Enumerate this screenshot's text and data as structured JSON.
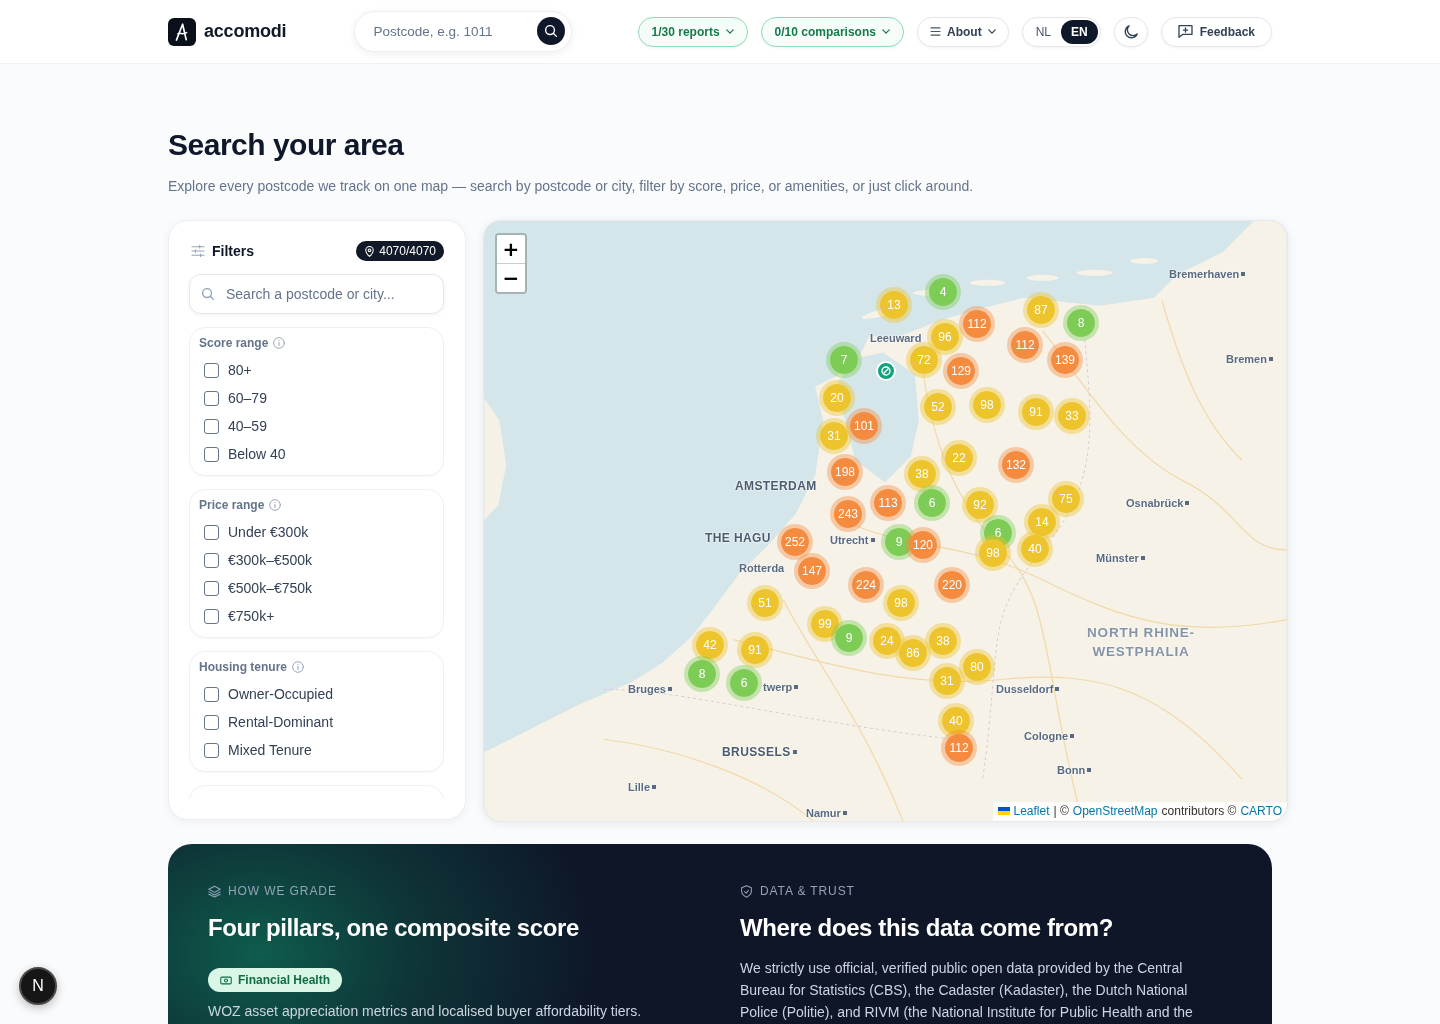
{
  "header": {
    "brand": "accomodi",
    "search": {
      "placeholder": "Postcode, e.g. 1011"
    },
    "counters": [
      {
        "label": "1/30 reports"
      },
      {
        "label": "0/10 comparisons"
      }
    ],
    "about": {
      "label": "About"
    },
    "languages": [
      {
        "label": "NL",
        "selected": false
      },
      {
        "label": "EN",
        "selected": true
      }
    ],
    "feedback": {
      "label": "Feedback"
    }
  },
  "intro": {
    "title": "Search your area",
    "subtitle": "Explore every postcode we track on one map — search by postcode or city, filter by score, price, or amenities, or just click around."
  },
  "filters": {
    "title": "Filters",
    "count": "4070/4070",
    "search": {
      "placeholder": "Search a postcode or city..."
    },
    "groups": [
      {
        "title": "Score range",
        "options": [
          {
            "label": "80+",
            "checked": false
          },
          {
            "label": "60–79",
            "checked": false
          },
          {
            "label": "40–59",
            "checked": false
          },
          {
            "label": "Below 40",
            "checked": false
          }
        ]
      },
      {
        "title": "Price range",
        "options": [
          {
            "label": "Under €300k",
            "checked": false
          },
          {
            "label": "€300k–€500k",
            "checked": false
          },
          {
            "label": "€500k–€750k",
            "checked": false
          },
          {
            "label": "€750k+",
            "checked": false
          }
        ]
      },
      {
        "title": "Housing tenure",
        "options": [
          {
            "label": "Owner-Occupied",
            "checked": false
          },
          {
            "label": "Rental-Dominant",
            "checked": false
          },
          {
            "label": "Mixed Tenure",
            "checked": false
          }
        ]
      }
    ]
  },
  "map": {
    "zoom": [
      {
        "label": "+"
      },
      {
        "label": "−"
      }
    ],
    "labels": [
      {
        "text": "Bremerhaven",
        "kind": "city",
        "dot": true
      },
      {
        "text": "Leeuward",
        "kind": "city",
        "dot": false
      },
      {
        "text": "Bremen",
        "kind": "city",
        "dot": true
      },
      {
        "text": "AMSTERDAM",
        "kind": "capital",
        "dot": false
      },
      {
        "text": "Osnabrück",
        "kind": "city",
        "dot": true
      },
      {
        "text": "THE HAGU",
        "kind": "capital",
        "dot": false
      },
      {
        "text": "Utrecht",
        "kind": "city",
        "dot": true
      },
      {
        "text": "Rotterda",
        "kind": "city",
        "dot": false
      },
      {
        "text": "Münster",
        "kind": "city",
        "dot": true
      },
      {
        "text": "NORTH RHINE-WESTPHALIA",
        "kind": "region",
        "dot": false
      },
      {
        "text": "Bruges",
        "kind": "city",
        "dot": true
      },
      {
        "text": "twerp",
        "kind": "city",
        "dot": true
      },
      {
        "text": "Dusseldorf",
        "kind": "city",
        "dot": true
      },
      {
        "text": "Cologne",
        "kind": "city",
        "dot": true
      },
      {
        "text": "BRUSSELS",
        "kind": "capital",
        "dot": true
      },
      {
        "text": "Bonn",
        "kind": "city",
        "dot": true
      },
      {
        "text": "Lille",
        "kind": "city",
        "dot": true
      },
      {
        "text": "Namur",
        "kind": "city",
        "dot": true
      }
    ],
    "markers": [
      {
        "count": "13",
        "color": "#edc42b"
      },
      {
        "count": "4",
        "color": "#7dcc55"
      },
      {
        "count": "112",
        "color": "#f48b3f"
      },
      {
        "count": "87",
        "color": "#edc42b"
      },
      {
        "count": "8",
        "color": "#7dcc55"
      },
      {
        "count": "96",
        "color": "#edc42b"
      },
      {
        "count": "112",
        "color": "#f48b3f"
      },
      {
        "count": "7",
        "color": "#7dcc55"
      },
      {
        "count": "72",
        "color": "#edc42b"
      },
      {
        "count": "139",
        "color": "#f48b3f"
      },
      {
        "count": "129",
        "color": "#f48b3f"
      },
      {
        "count": "20",
        "color": "#edc42b"
      },
      {
        "count": "52",
        "color": "#edc42b"
      },
      {
        "count": "98",
        "color": "#edc42b"
      },
      {
        "count": "91",
        "color": "#edc42b"
      },
      {
        "count": "33",
        "color": "#edc42b"
      },
      {
        "count": "101",
        "color": "#f48b3f"
      },
      {
        "count": "31",
        "color": "#edc42b"
      },
      {
        "count": "198",
        "color": "#f48b3f"
      },
      {
        "count": "38",
        "color": "#edc42b"
      },
      {
        "count": "22",
        "color": "#edc42b"
      },
      {
        "count": "132",
        "color": "#f48b3f"
      },
      {
        "count": "113",
        "color": "#f48b3f"
      },
      {
        "count": "6",
        "color": "#7dcc55"
      },
      {
        "count": "92",
        "color": "#edc42b"
      },
      {
        "count": "75",
        "color": "#edc42b"
      },
      {
        "count": "243",
        "color": "#f48b3f"
      },
      {
        "count": "14",
        "color": "#edc42b"
      },
      {
        "count": "6",
        "color": "#7dcc55"
      },
      {
        "count": "252",
        "color": "#f48b3f"
      },
      {
        "count": "9",
        "color": "#7dcc55"
      },
      {
        "count": "120",
        "color": "#f48b3f"
      },
      {
        "count": "98",
        "color": "#edc42b"
      },
      {
        "count": "40",
        "color": "#edc42b"
      },
      {
        "count": "147",
        "color": "#f48b3f"
      },
      {
        "count": "224",
        "color": "#f48b3f"
      },
      {
        "count": "220",
        "color": "#f48b3f"
      },
      {
        "count": "51",
        "color": "#edc42b"
      },
      {
        "count": "98",
        "color": "#edc42b"
      },
      {
        "count": "99",
        "color": "#edc42b"
      },
      {
        "count": "42",
        "color": "#edc42b"
      },
      {
        "count": "91",
        "color": "#edc42b"
      },
      {
        "count": "9",
        "color": "#7dcc55"
      },
      {
        "count": "24",
        "color": "#edc42b"
      },
      {
        "count": "86",
        "color": "#edc42b"
      },
      {
        "count": "38",
        "color": "#edc42b"
      },
      {
        "count": "8",
        "color": "#7dcc55"
      },
      {
        "count": "6",
        "color": "#7dcc55"
      },
      {
        "count": "31",
        "color": "#edc42b"
      },
      {
        "count": "80",
        "color": "#edc42b"
      },
      {
        "count": "40",
        "color": "#edc42b"
      },
      {
        "count": "112",
        "color": "#f48b3f"
      }
    ],
    "attribution": [
      {
        "kind": "link",
        "text": "Leaflet"
      },
      {
        "kind": "text",
        "text": "| ©"
      },
      {
        "kind": "link",
        "text": "OpenStreetMap"
      },
      {
        "kind": "text",
        "text": "contributors ©"
      },
      {
        "kind": "link",
        "text": "CARTO"
      }
    ]
  },
  "info": {
    "columns": [
      {
        "kind": "grade",
        "eyebrow": "HOW WE GRADE",
        "title": "Four pillars, one composite score",
        "pill": "Financial Health",
        "text": "WOZ asset appreciation metrics and localised buyer affordability tiers."
      },
      {
        "kind": "trust",
        "eyebrow": "DATA & TRUST",
        "title": "Where does this data come from?",
        "text": "We strictly use official, verified public open data provided by the Central Bureau for Statistics (CBS), the Cadaster (Kadaster), the Dutch National Police (Politie), and RIVM (the National Institute for Public Health and the"
      }
    ]
  },
  "dev_badge": {
    "label": "N"
  }
}
